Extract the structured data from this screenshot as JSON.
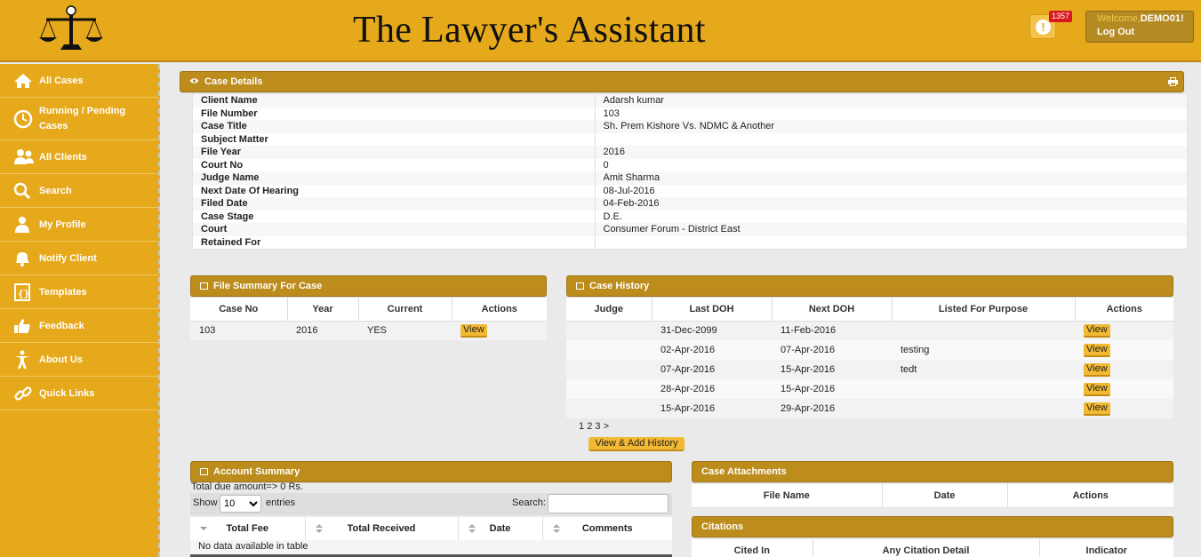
{
  "app": {
    "title": "The Lawyer's Assistant",
    "notification_count": "1357",
    "notification_glyph": "!",
    "welcome_label": "Welcome,",
    "username": "DEMO01!",
    "logout_label": "Log Out"
  },
  "sidebar": {
    "items": [
      {
        "label": "All Cases",
        "icon": "home-icon"
      },
      {
        "label": "Running / Pending Cases",
        "icon": "clock-icon"
      },
      {
        "label": "All Clients",
        "icon": "users-icon"
      },
      {
        "label": "Search",
        "icon": "search-icon"
      },
      {
        "label": "My Profile",
        "icon": "profile-icon"
      },
      {
        "label": "Notify Client",
        "icon": "bell-icon"
      },
      {
        "label": "Templates",
        "icon": "template-icon"
      },
      {
        "label": "Feedback",
        "icon": "thumbs-up-icon"
      },
      {
        "label": "About Us",
        "icon": "person-icon"
      },
      {
        "label": "Quick Links",
        "icon": "link-icon"
      }
    ]
  },
  "case_details": {
    "title": "Case Details",
    "rows": [
      {
        "label": "Client Name",
        "value": "Adarsh kumar"
      },
      {
        "label": "File Number",
        "value": "103"
      },
      {
        "label": "Case Title",
        "value": "Sh. Prem Kishore Vs. NDMC & Another"
      },
      {
        "label": "Subject Matter",
        "value": ""
      },
      {
        "label": "File Year",
        "value": "2016"
      },
      {
        "label": "Court No",
        "value": "0"
      },
      {
        "label": "Judge Name",
        "value": "Amit Sharma"
      },
      {
        "label": "Next Date Of Hearing",
        "value": "08-Jul-2016"
      },
      {
        "label": "Filed Date",
        "value": "04-Feb-2016"
      },
      {
        "label": "Case Stage",
        "value": "D.E."
      },
      {
        "label": "Court",
        "value": "Consumer Forum - District East"
      },
      {
        "label": "Retained For",
        "value": ""
      }
    ]
  },
  "file_summary": {
    "title": "File Summary For Case",
    "columns": [
      "Case No",
      "Year",
      "Current",
      "Actions"
    ],
    "rows": [
      {
        "case_no": "103",
        "year": "2016",
        "current": "YES",
        "action": "View"
      }
    ]
  },
  "case_history": {
    "title": "Case History",
    "columns": [
      "Judge",
      "Last DOH",
      "Next DOH",
      "Listed For Purpose",
      "Actions"
    ],
    "rows": [
      {
        "judge": "",
        "last": "31-Dec-2099",
        "next": "11-Feb-2016",
        "purpose": "",
        "action": "View"
      },
      {
        "judge": "",
        "last": "02-Apr-2016",
        "next": "07-Apr-2016",
        "purpose": "testing",
        "action": "View"
      },
      {
        "judge": "",
        "last": "07-Apr-2016",
        "next": "15-Apr-2016",
        "purpose": "tedt",
        "action": "View"
      },
      {
        "judge": "",
        "last": "28-Apr-2016",
        "next": "15-Apr-2016",
        "purpose": "",
        "action": "View"
      },
      {
        "judge": "",
        "last": "15-Apr-2016",
        "next": "29-Apr-2016",
        "purpose": "",
        "action": "View"
      }
    ],
    "pages": [
      "1",
      "2",
      "3",
      ">"
    ],
    "add_button": "View & Add History"
  },
  "account_summary": {
    "title": "Account Summary",
    "due_note": "Total due amount=> 0 Rs.",
    "show_label": "Show",
    "page_size": "10",
    "entries_label": "entries",
    "search_label": "Search:",
    "columns": [
      "Total Fee",
      "Total Received",
      "Date",
      "Comments"
    ],
    "empty_text": "No data available in table"
  },
  "attachments": {
    "title": "Case Attachments",
    "columns": [
      "File Name",
      "Date",
      "Actions"
    ]
  },
  "citations": {
    "title": "Citations",
    "columns": [
      "Cited In",
      "Any Citation Detail",
      "Indicator"
    ]
  }
}
